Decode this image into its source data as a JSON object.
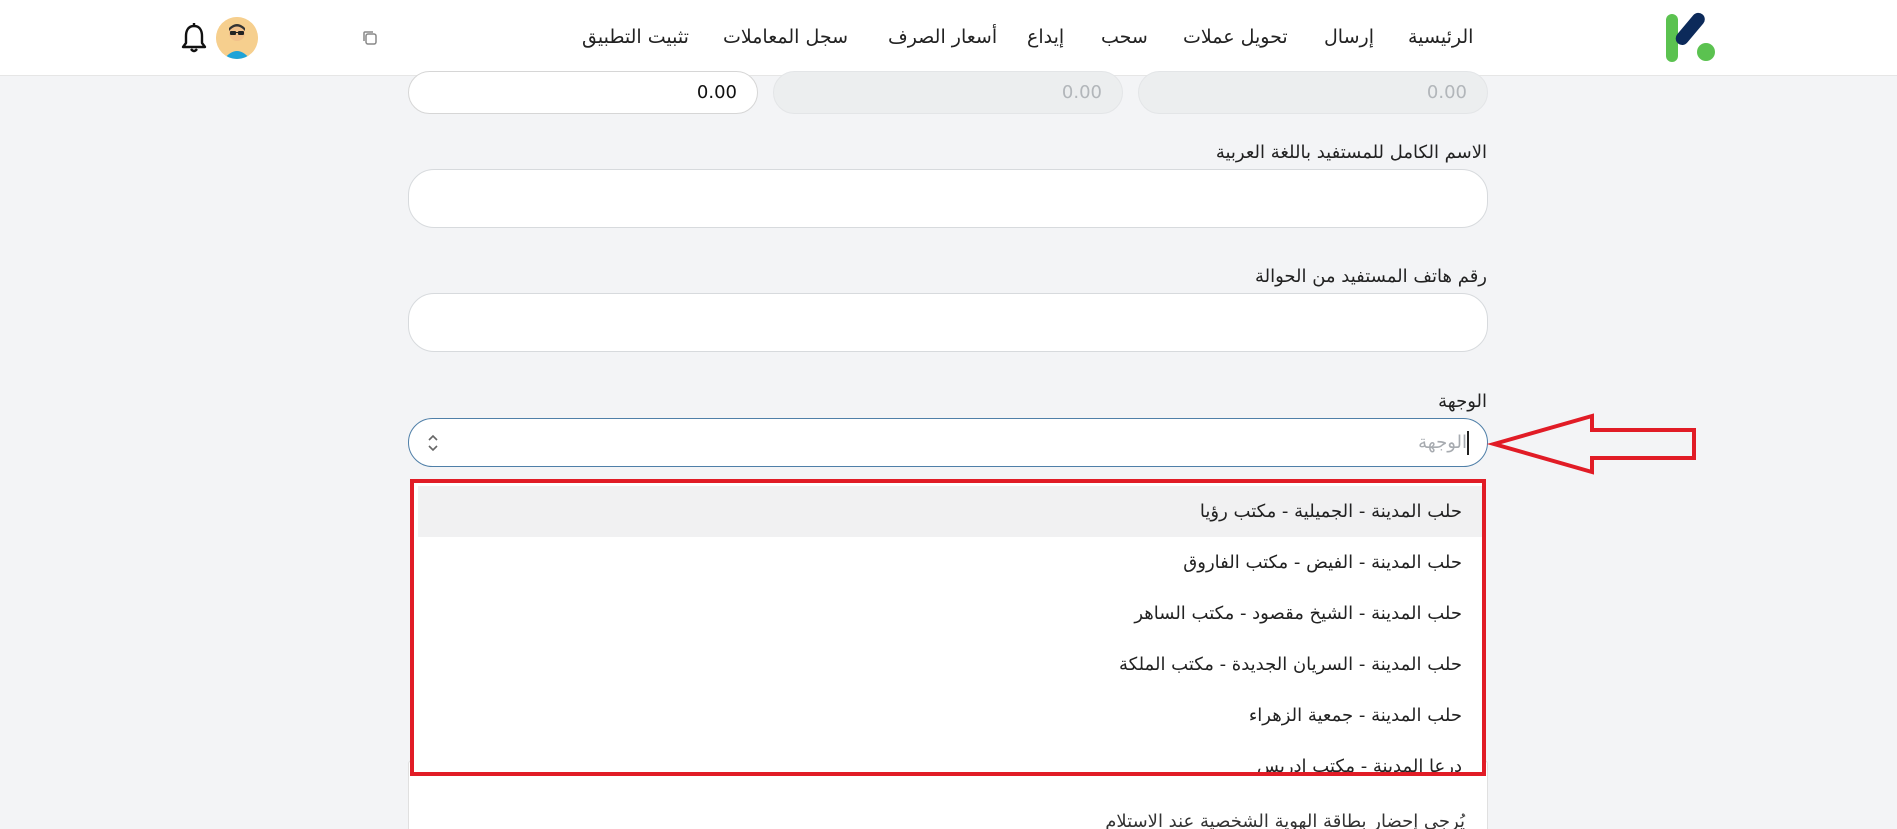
{
  "header": {
    "nav": [
      {
        "id": "home",
        "label": "الرئيسية"
      },
      {
        "id": "send",
        "label": "إرسال"
      },
      {
        "id": "exchange",
        "label": "تحويل عملات"
      },
      {
        "id": "withdraw",
        "label": "سحب"
      },
      {
        "id": "deposit",
        "label": "إيداع"
      },
      {
        "id": "rates",
        "label": "أسعار الصرف"
      },
      {
        "id": "history",
        "label": "سجل المعاملات"
      },
      {
        "id": "install",
        "label": "تثبيت التطبيق"
      }
    ],
    "icons": {
      "logo": "app-logo",
      "copy": "copy-icon",
      "avatar": "avatar",
      "bell": "bell-icon"
    }
  },
  "form": {
    "amounts": [
      "0.00",
      "0.00",
      "0.00"
    ],
    "beneficiary_name_label": "الاسم الكامل للمستفيد باللغة العربية",
    "beneficiary_phone_label": "رقم هاتف المستفيد من الحوالة",
    "destination_label": "الوجهة",
    "destination_placeholder": "الوجهة",
    "partial_note": "يُرجى إحضار بطاقة الهوية الشخصية عند الاستلام"
  },
  "dropdown": {
    "options": [
      "حلب المدينة - الجميلية - مكتب رؤيا",
      "حلب المدينة - الفيض - مكتب الفاروق",
      "حلب المدينة - الشيخ مقصود - مكتب الساهر",
      "حلب المدينة - السريان الجديدة - مكتب الملكة",
      "حلب المدينة - جمعية الزهراء",
      "درعا المدينة - مكتب ادريس"
    ]
  },
  "colors": {
    "highlight": "#e11c26",
    "focus_border": "#4f7fa8",
    "logo_green": "#5bc250",
    "logo_navy": "#0c2a5a"
  }
}
